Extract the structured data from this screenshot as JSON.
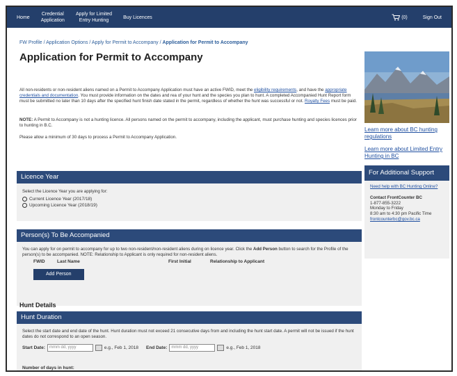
{
  "nav": {
    "home": "Home",
    "credential": "Credential\nApplication",
    "limited": "Apply for Limited\nEntry Hunting",
    "buy": "Buy Licences",
    "cart_count": "(0)",
    "signout": "Sign Out"
  },
  "breadcrumb": {
    "c1": "FW Profile",
    "c2": "Application Options",
    "c3": "Apply for Permit to Accompany",
    "current": "Application for Permit to Accompany",
    "sep": " / "
  },
  "page": {
    "title": "Application for Permit to Accompany",
    "intro_a": "All non-residents or non-resident aliens named on a Permit to Accompany Application must have an active FWID, meet the ",
    "intro_link1": "eligibility requirements",
    "intro_b": ", and have the ",
    "intro_link2": "appropriate credentials and documentation",
    "intro_c": ". You must provide information on the dates and rea of your hunt and the species you plan to hunt. A completed Accompanied Hunt Report form must be submitted no later than 10 days after the specified hunt finish date stated in the permit, regardless of whether the hunt was successful or not. ",
    "intro_link3": "Royalty Fees",
    "intro_d": " must be paid.",
    "note_label": "NOTE:",
    "note_text": " A Permit to Accompany is not a hunting licence. All persons named on the permit to accompany, including the applicant, must purchase hunting and species licences prior to hunting in B.C.",
    "allow": "Please allow a minimum of 30 days to process a Permit to Accompany Application."
  },
  "licence_year": {
    "heading": "Licence Year",
    "prompt": "Select the Licence Year you are applying for:",
    "options": [
      "Current Licence Year (2017/18)",
      "Upcoming Licence Year (2018/19)"
    ]
  },
  "persons": {
    "heading": "Person(s) To Be Accompanied",
    "desc_a": "You can apply for on permit to accompany for up to two non-resident/non-resident aliens during on licence year. Click the ",
    "desc_bold": "Add Person",
    "desc_b": " button to search for the Profile of the person(s) to be accompanied. NOTE: Relationship to Applicant is only required for non-resident aliens.",
    "columns": [
      "FWID",
      "Last Name",
      "First Initial",
      "Relationship to Applicant"
    ],
    "add_button": "Add Person"
  },
  "hunt": {
    "details_title": "Hunt Details",
    "heading": "Hunt Duration",
    "desc": "Select the start date and end date of the hunt. Hunt duration must not exceed 21 consecutive days from and including the hunt start date. A permit will not be issued if the hunt dates do not correspond to an open season.",
    "start_label": "Start Date:",
    "end_label": "End Date:",
    "placeholder": "mmm dd, yyyy",
    "example": "e.g., Feb 1, 2018",
    "days_label": "Number of days in hunt:"
  },
  "sidebar": {
    "link1": "Learn more about BC hunting regulations",
    "link2": "Learn more about Limited Entry Hunting in BC",
    "support_heading": "For Additional Support",
    "help_link": "Need help with BC Hunting Online?",
    "contact_title": "Contact FrontCounter BC",
    "phone": "1-877-855-3222",
    "days": "Monday to Friday",
    "hours": "8:30 am to 4:30 pm Pacific Time",
    "email": "frontcounterbc@gov.bc.ca"
  }
}
